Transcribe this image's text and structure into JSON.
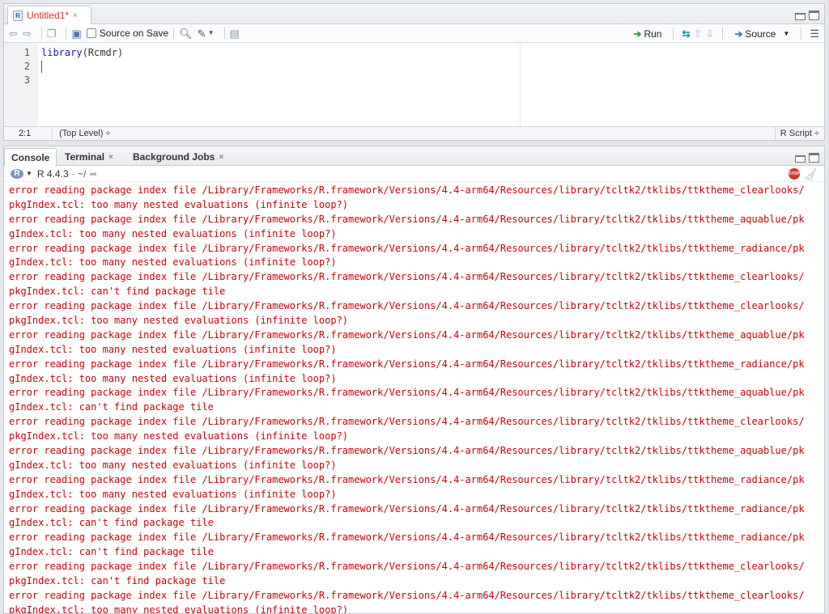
{
  "editor": {
    "tab": {
      "icon": "r-file-icon",
      "label": "Untitled1*",
      "close": "×"
    },
    "toolbar": {
      "source_on_save_label": "Source on Save",
      "run_label": "Run",
      "source_label": "Source"
    },
    "gutter": [
      "1",
      "2",
      "3"
    ],
    "code": {
      "line1_fn": "library",
      "line1_rest": "(Rcmdr)"
    },
    "status": {
      "position": "2:1",
      "scope": "(Top Level) ÷",
      "language": "R Script ÷"
    }
  },
  "console": {
    "tabs": [
      {
        "label": "Console"
      },
      {
        "label": "Terminal"
      },
      {
        "label": "Background Jobs"
      }
    ],
    "tab_close": "×",
    "r_version": "R 4.4.3",
    "path": "· ~/",
    "stop_label": "STOP",
    "lines": [
      "error reading package index file /Library/Frameworks/R.framework/Versions/4.4-arm64/Resources/library/tcltk2/tklibs/ttktheme_clearlooks/",
      "pkgIndex.tcl: too many nested evaluations (infinite loop?)",
      "error reading package index file /Library/Frameworks/R.framework/Versions/4.4-arm64/Resources/library/tcltk2/tklibs/ttktheme_aquablue/pk",
      "gIndex.tcl: too many nested evaluations (infinite loop?)",
      "error reading package index file /Library/Frameworks/R.framework/Versions/4.4-arm64/Resources/library/tcltk2/tklibs/ttktheme_radiance/pk",
      "gIndex.tcl: too many nested evaluations (infinite loop?)",
      "error reading package index file /Library/Frameworks/R.framework/Versions/4.4-arm64/Resources/library/tcltk2/tklibs/ttktheme_clearlooks/",
      "pkgIndex.tcl: can't find package tile",
      "error reading package index file /Library/Frameworks/R.framework/Versions/4.4-arm64/Resources/library/tcltk2/tklibs/ttktheme_clearlooks/",
      "pkgIndex.tcl: too many nested evaluations (infinite loop?)",
      "error reading package index file /Library/Frameworks/R.framework/Versions/4.4-arm64/Resources/library/tcltk2/tklibs/ttktheme_aquablue/pk",
      "gIndex.tcl: too many nested evaluations (infinite loop?)",
      "error reading package index file /Library/Frameworks/R.framework/Versions/4.4-arm64/Resources/library/tcltk2/tklibs/ttktheme_radiance/pk",
      "gIndex.tcl: too many nested evaluations (infinite loop?)",
      "error reading package index file /Library/Frameworks/R.framework/Versions/4.4-arm64/Resources/library/tcltk2/tklibs/ttktheme_aquablue/pk",
      "gIndex.tcl: can't find package tile",
      "error reading package index file /Library/Frameworks/R.framework/Versions/4.4-arm64/Resources/library/tcltk2/tklibs/ttktheme_clearlooks/",
      "pkgIndex.tcl: too many nested evaluations (infinite loop?)",
      "error reading package index file /Library/Frameworks/R.framework/Versions/4.4-arm64/Resources/library/tcltk2/tklibs/ttktheme_aquablue/pk",
      "gIndex.tcl: too many nested evaluations (infinite loop?)",
      "error reading package index file /Library/Frameworks/R.framework/Versions/4.4-arm64/Resources/library/tcltk2/tklibs/ttktheme_radiance/pk",
      "gIndex.tcl: too many nested evaluations (infinite loop?)",
      "error reading package index file /Library/Frameworks/R.framework/Versions/4.4-arm64/Resources/library/tcltk2/tklibs/ttktheme_radiance/pk",
      "gIndex.tcl: can't find package tile",
      "error reading package index file /Library/Frameworks/R.framework/Versions/4.4-arm64/Resources/library/tcltk2/tklibs/ttktheme_radiance/pk",
      "gIndex.tcl: can't find package tile",
      "error reading package index file /Library/Frameworks/R.framework/Versions/4.4-arm64/Resources/library/tcltk2/tklibs/ttktheme_clearlooks/",
      "pkgIndex.tcl: can't find package tile",
      "error reading package index file /Library/Frameworks/R.framework/Versions/4.4-arm64/Resources/library/tcltk2/tklibs/ttktheme_clearlooks/",
      "pkgIndex.tcl: too many nested evaluations (infinite loop?)"
    ]
  },
  "colors": {
    "error_text": "#c5060b",
    "modified_tab": "#d0342c",
    "function_name": "#1a1aa6",
    "run_arrow": "#2e9e3a",
    "stop": "#d5352a"
  }
}
